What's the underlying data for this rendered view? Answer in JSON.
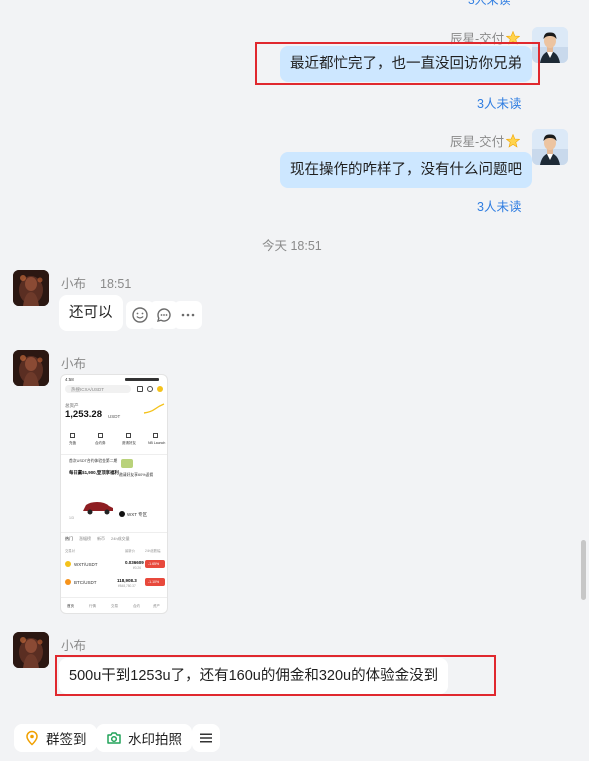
{
  "messages": [
    {
      "sender": "辰星-交付",
      "text": "最近都忙完了，也一直没回访你兄弟",
      "status": "3人未读"
    },
    {
      "sender": "辰星-交付",
      "text": "现在操作的咋样了，没有什么问题吧",
      "status": "3人未读"
    }
  ],
  "divider_time": "今天 18:51",
  "replies": [
    {
      "sender": "小布",
      "time": "18:51",
      "text": "还可以"
    },
    {
      "sender": "小布"
    },
    {
      "sender": "小布",
      "text": "500u干到1253u了，还有160u的佣金和320u的体验金没到"
    }
  ],
  "screenshot": {
    "status_time": "4:58",
    "search": "热搜ICXA/USDT",
    "asset_label": "总资产",
    "balance": "1,253.28",
    "unit": "USDT",
    "menu": [
      "充值",
      "合约券",
      "邀请好友",
      "NB Launch"
    ],
    "promo_title": "首次USDT合约体验金第二期",
    "promo_big": "每日赢$1,900,登顶享福利",
    "promo_right": "邀请好友享60%返佣",
    "page_indicator": "1/3",
    "zone": "WXT 专区",
    "tabs": [
      "热门",
      "涨幅榜",
      "新币",
      "24h成交量"
    ],
    "col_left": "交易对",
    "col_mid": "最新价",
    "col_right": "24h涨跌幅",
    "rows": [
      {
        "coin": "WXT/USDT",
        "price": "0.036609",
        "sub": "¥0.26",
        "change": "-1.65%"
      },
      {
        "coin": "BTC/USDT",
        "price": "118,908.3",
        "sub": "¥848,780.37",
        "change": "-1.10%"
      }
    ],
    "nav": [
      "首页",
      "行情",
      "交易",
      "合约",
      "资产"
    ]
  },
  "toolbar": {
    "checkin": "群签到",
    "watermark": "水印拍照"
  },
  "colors": {
    "bubble_self": "#cde7ff",
    "link_blue": "#2f7de1",
    "highlight_red": "#e0282e"
  }
}
